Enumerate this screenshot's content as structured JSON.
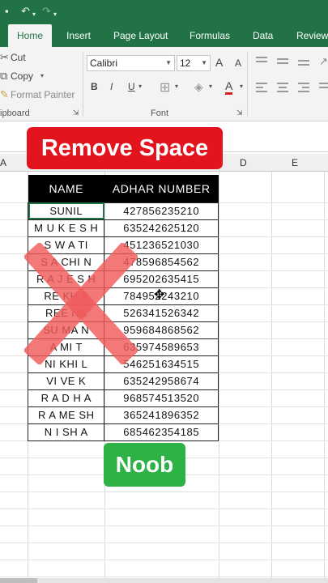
{
  "quick_access": {
    "save_icon": "save-icon",
    "undo_icon": "undo-icon",
    "redo_icon": "redo-icon",
    "customize_icon": "dropdown-icon"
  },
  "tabs": [
    {
      "label": "Home",
      "active": true
    },
    {
      "label": "Insert"
    },
    {
      "label": "Page Layout"
    },
    {
      "label": "Formulas"
    },
    {
      "label": "Data"
    },
    {
      "label": "Review"
    }
  ],
  "ribbon": {
    "clipboard": {
      "cut": "Cut",
      "copy": "Copy",
      "format_painter": "Format Painter",
      "group_label": "ipboard"
    },
    "font": {
      "font_name": "Calibri",
      "font_size": "12",
      "bold": "B",
      "italic": "I",
      "underline": "U",
      "group_label": "Font",
      "grow": "A",
      "shrink": "A",
      "font_color": "A"
    }
  },
  "columns": [
    "A",
    "D",
    "E"
  ],
  "overlay": {
    "title": "Remove Space",
    "verdict": "Noob"
  },
  "table": {
    "headers": [
      "NAME",
      "ADHAR NUMBER"
    ],
    "rows": [
      {
        "name": "SUNIL",
        "number": "427856235210"
      },
      {
        "name": "M U K E S H",
        "number": "635242625120"
      },
      {
        "name": "S W A TI",
        "number": "451236521030"
      },
      {
        "name": "S A CHI N",
        "number": "478596854562"
      },
      {
        "name": "R A J E S H",
        "number": "695202635415"
      },
      {
        "name": "RE KH A",
        "number": "784952243210"
      },
      {
        "name": "REE NA",
        "number": "526341526342"
      },
      {
        "name": "SU MA N",
        "number": "959684868562"
      },
      {
        "name": "A MI T",
        "number": "635974589653"
      },
      {
        "name": "NI KHI L",
        "number": "546251634515"
      },
      {
        "name": "VI VE K",
        "number": "635242958674"
      },
      {
        "name": "R A D H A",
        "number": "968574513520"
      },
      {
        "name": "R A ME SH",
        "number": "365241896352"
      },
      {
        "name": "N I SH A",
        "number": "685462354185"
      }
    ]
  },
  "colors": {
    "excel_green": "#217346",
    "badge_red": "#e3141d",
    "badge_green": "#2db245",
    "cross": "#f05a5a"
  }
}
